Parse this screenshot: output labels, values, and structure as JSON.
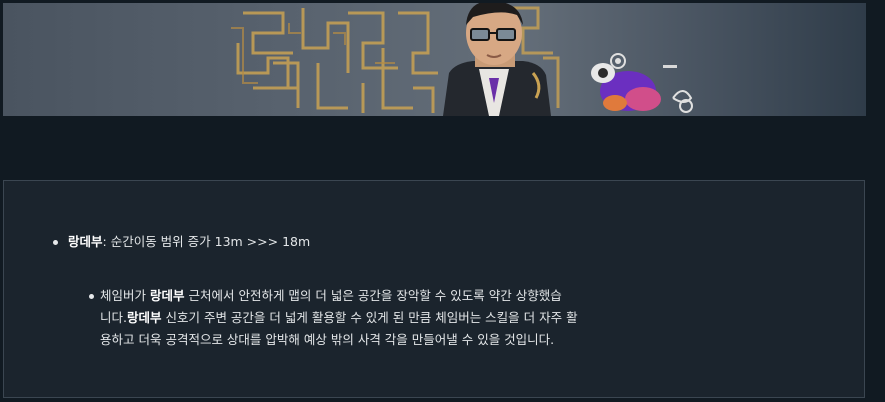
{
  "patch_note": {
    "item": {
      "agent": "랑데부",
      "change": ": 순간이동 범위 증가 13m >>> 18m"
    },
    "detail": {
      "line1_pre": "체임버가 ",
      "line1_agent": "랑데부",
      "line1_post": " 근처에서 안전하게 맵의 더 넓은 공간을 장악할 수 있도록 약간 상향했습",
      "line2_pre": "니다.",
      "line2_agent": "랑데부",
      "line2_post": " 신호기 주변 공간을 더 넓게 활용할 수 있게 된 만큼 체임버는 스킬을 더 자주 활",
      "line3": "용하고 더욱 공격적으로 상대를 압박해 예상 밖의 사격 각을 만들어낼 수 있을 것입니다."
    }
  }
}
